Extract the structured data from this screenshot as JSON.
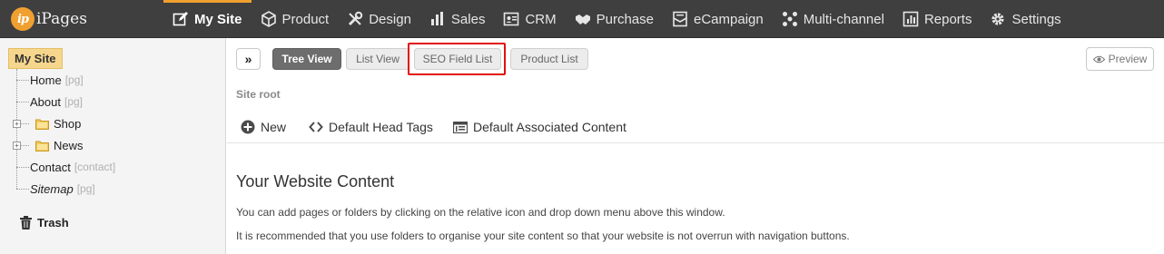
{
  "app": {
    "logo_badge": "ip",
    "logo_text": "iPages"
  },
  "nav": [
    {
      "label": "My Site",
      "icon": "edit-icon",
      "active": true
    },
    {
      "label": "Product",
      "icon": "cube-icon"
    },
    {
      "label": "Design",
      "icon": "tools-icon"
    },
    {
      "label": "Sales",
      "icon": "bar-chart-icon"
    },
    {
      "label": "CRM",
      "icon": "id-card-icon"
    },
    {
      "label": "Purchase",
      "icon": "handshake-icon"
    },
    {
      "label": "eCampaign",
      "icon": "envelope-icon"
    },
    {
      "label": "Multi-channel",
      "icon": "network-icon"
    },
    {
      "label": "Reports",
      "icon": "report-icon"
    },
    {
      "label": "Settings",
      "icon": "gear-icon"
    }
  ],
  "sidebar": {
    "root": "My Site",
    "items": [
      {
        "label": "Home",
        "tag": "[pg]"
      },
      {
        "label": "About",
        "tag": "[pg]"
      },
      {
        "label": "Shop",
        "folder": true
      },
      {
        "label": "News",
        "folder": true
      },
      {
        "label": "Contact",
        "tag": "[contact]"
      },
      {
        "label": "Sitemap",
        "tag": "[pg]",
        "italic": true
      }
    ],
    "trash": "Trash"
  },
  "toolbar": {
    "expand": "»",
    "views": [
      "Tree View",
      "List View",
      "SEO Field List",
      "Product List"
    ],
    "active_view": "Tree View",
    "highlighted_view": "SEO Field List",
    "preview": "Preview"
  },
  "main": {
    "breadcrumb": "Site root",
    "actions": {
      "new": "New",
      "head_tags": "Default Head Tags",
      "assoc": "Default Associated Content"
    },
    "title": "Your Website Content",
    "para1": "You can add pages or folders by clicking on the relative icon and drop down menu above this window.",
    "para2": "It is recommended that you use folders to organise your site content so that your website is not overrun with navigation buttons."
  },
  "colors": {
    "accent": "#f0a030",
    "topbar": "#3f3f3f",
    "highlight": "#e01010"
  }
}
